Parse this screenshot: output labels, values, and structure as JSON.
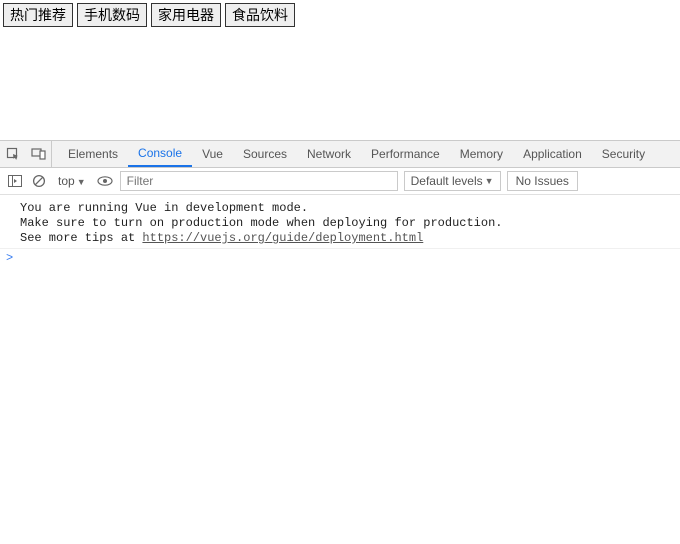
{
  "page": {
    "tabs": [
      {
        "label": "热门推荐"
      },
      {
        "label": "手机数码"
      },
      {
        "label": "家用电器"
      },
      {
        "label": "食品饮料"
      }
    ]
  },
  "devtools": {
    "tabs": [
      {
        "label": "Elements"
      },
      {
        "label": "Console",
        "active": true
      },
      {
        "label": "Vue"
      },
      {
        "label": "Sources"
      },
      {
        "label": "Network"
      },
      {
        "label": "Performance"
      },
      {
        "label": "Memory"
      },
      {
        "label": "Application"
      },
      {
        "label": "Security"
      }
    ]
  },
  "console": {
    "context": "top",
    "filter_placeholder": "Filter",
    "levels_label": "Default levels",
    "issues_label": "No Issues",
    "message_line1": "You are running Vue in development mode.",
    "message_line2": "Make sure to turn on production mode when deploying for production.",
    "message_line3_prefix": "See more tips at ",
    "message_link": "https://vuejs.org/guide/deployment.html",
    "prompt": ">"
  }
}
